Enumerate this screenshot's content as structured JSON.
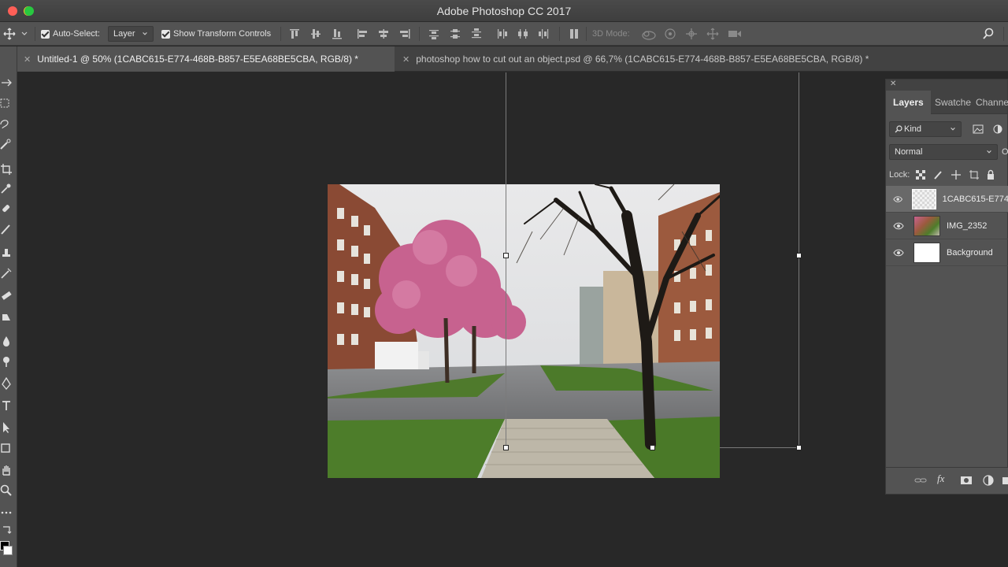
{
  "window": {
    "title": "Adobe Photoshop CC 2017"
  },
  "options_bar": {
    "auto_select_label": "Auto-Select:",
    "auto_select_value": "Layer",
    "show_transform_label": "Show Transform Controls",
    "mode_3d_label": "3D Mode:"
  },
  "tabs": [
    {
      "label": "Untitled-1 @ 50% (1CABC615-E774-468B-B857-E5EA68BE5CBA, RGB/8) *",
      "active": true
    },
    {
      "label": "photoshop how to cut out an object.psd @ 66,7% (1CABC615-E774-468B-B857-E5EA68BE5CBA, RGB/8) *",
      "active": false
    }
  ],
  "layers_panel": {
    "tabs": [
      "Layers",
      "Swatche",
      "Channe"
    ],
    "filter_label": "Kind",
    "blend_mode": "Normal",
    "opacity_label": "O",
    "lock_label": "Lock:",
    "layers": [
      {
        "name": "1CABC615-E774",
        "selected": true
      },
      {
        "name": "IMG_2352",
        "selected": false
      },
      {
        "name": "Background",
        "selected": false
      }
    ]
  },
  "colors": {
    "accent_close": "#ff5f57",
    "accent_min": "#febc2e",
    "accent_max": "#28c840"
  }
}
